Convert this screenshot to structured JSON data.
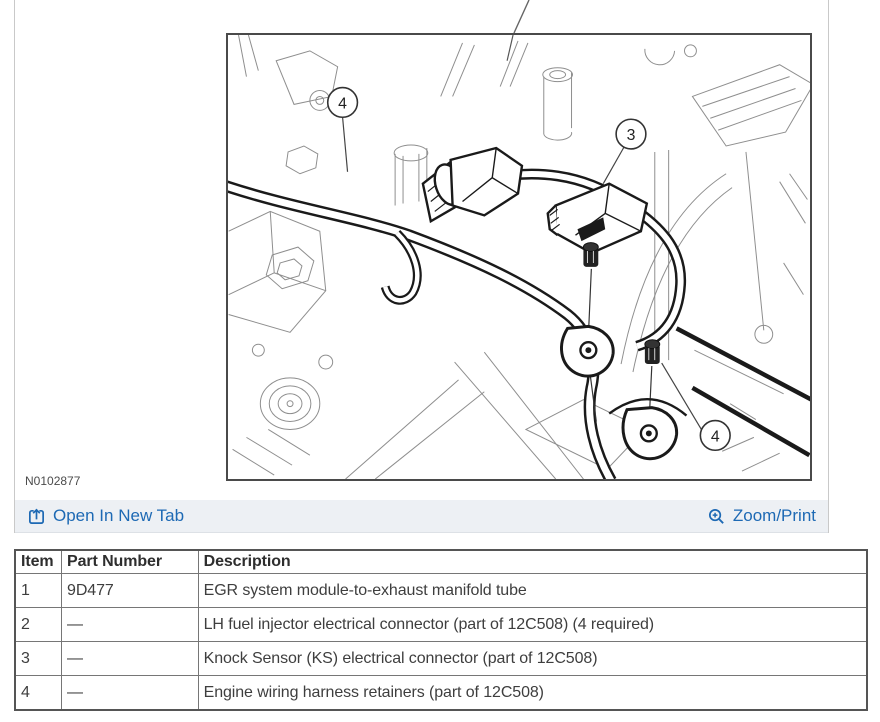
{
  "figure": {
    "id_label": "N0102877",
    "callouts": [
      {
        "label": "4",
        "position": "upper-left"
      },
      {
        "label": "3",
        "position": "upper-right"
      },
      {
        "label": "4",
        "position": "lower-right"
      }
    ]
  },
  "toolbar": {
    "open_in_new_tab_label": "Open In New Tab",
    "zoom_print_label": "Zoom/Print"
  },
  "parts_table": {
    "headers": [
      "Item",
      "Part Number",
      "Description"
    ],
    "rows": [
      [
        "1",
        "9D477",
        "EGR system module-to-exhaust manifold tube"
      ],
      [
        "2",
        "—",
        "LH fuel injector electrical connector (part of 12C508) (4 required)"
      ],
      [
        "3",
        "—",
        "Knock Sensor (KS) electrical connector (part of 12C508)"
      ],
      [
        "4",
        "—",
        "Engine wiring harness retainers (part of 12C508)"
      ]
    ]
  },
  "colors": {
    "link_blue": "#1d69b4",
    "toolbar_bg": "#edf0f4",
    "table_border": "#767676",
    "frame_border": "#4a4a4a",
    "drawing_gray": "#8e8e8e",
    "drawing_dark": "#1a1a1a"
  },
  "icons": {
    "open_in_new_tab": "open-in-new-tab-icon",
    "zoom_print": "magnifier-plus-icon"
  }
}
